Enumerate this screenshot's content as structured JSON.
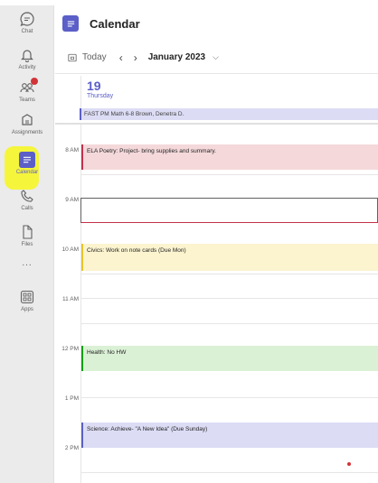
{
  "rail": {
    "items": [
      {
        "label": "Chat",
        "icon": "chat-icon"
      },
      {
        "label": "Activity",
        "icon": "bell-icon"
      },
      {
        "label": "Teams",
        "icon": "teams-icon"
      },
      {
        "label": "Assignments",
        "icon": "assignments-icon"
      },
      {
        "label": "Calendar",
        "icon": "calendar-icon"
      },
      {
        "label": "Calls",
        "icon": "phone-icon"
      },
      {
        "label": "Files",
        "icon": "file-icon"
      },
      {
        "label": "...",
        "icon": "more-icon"
      },
      {
        "label": "Apps",
        "icon": "apps-icon"
      }
    ],
    "active": "Calendar",
    "highlight_color": "#f5f53c"
  },
  "header": {
    "title": "Calendar"
  },
  "toolbar": {
    "today_label": "Today",
    "prev": "‹",
    "next": "›",
    "month": "January 2023",
    "month_chevron": "⌵"
  },
  "day": {
    "number": "19",
    "name": "Thursday"
  },
  "allday_event": "FAST PM Math 6-8  Brown, Denetra D.",
  "times": [
    "8 AM",
    "9 AM",
    "10 AM",
    "11 AM",
    "12 PM",
    "1 PM",
    "2 PM"
  ],
  "events": [
    {
      "title": "ELA Poetry: Project- bring supplies and summary.",
      "bg": "#f4d8da",
      "border": "#c4314b"
    },
    {
      "title": "Civics: Work on note cards (Due Mon)",
      "bg": "#fcf4cf",
      "border": "#e8c42a"
    },
    {
      "title": "Health: No HW",
      "bg": "#dbf1d6",
      "border": "#13a10e"
    },
    {
      "title": "Science: Achieve- \"A New Idea\" (Due Sunday)",
      "bg": "#dcdcf5",
      "border": "#5b5fc7"
    }
  ],
  "colors": {
    "accent": "#5b5fc7",
    "now_line": "#c4314b"
  }
}
